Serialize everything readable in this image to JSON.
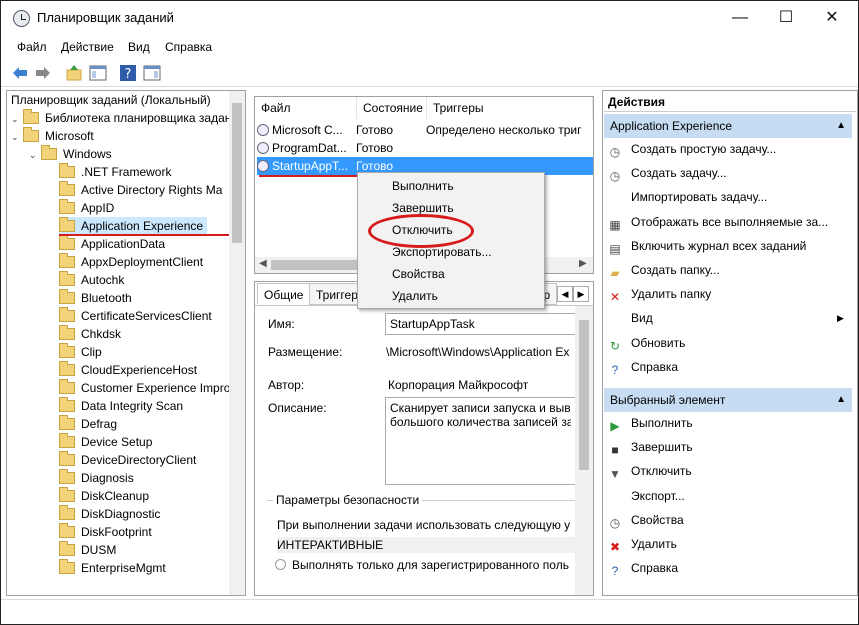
{
  "window": {
    "title": "Планировщик заданий"
  },
  "menu": [
    "Файл",
    "Действие",
    "Вид",
    "Справка"
  ],
  "tree": {
    "root": "Планировщик заданий (Локальный)",
    "library": "Библиотека планировщика заданий",
    "microsoft": "Microsoft",
    "windows": "Windows",
    "items": [
      ".NET Framework",
      "Active Directory Rights Ma",
      "AppID",
      "Application Experience",
      "ApplicationData",
      "AppxDeploymentClient",
      "Autochk",
      "Bluetooth",
      "CertificateServicesClient",
      "Chkdsk",
      "Clip",
      "CloudExperienceHost",
      "Customer Experience Impro",
      "Data Integrity Scan",
      "Defrag",
      "Device Setup",
      "DeviceDirectoryClient",
      "Diagnosis",
      "DiskCleanup",
      "DiskDiagnostic",
      "DiskFootprint",
      "DUSM",
      "EnterpriseMgmt"
    ]
  },
  "tasks": {
    "columns": [
      "Файл",
      "Состояние",
      "Триггеры"
    ],
    "rows": [
      {
        "name": "Microsoft C...",
        "status": "Готово",
        "trigger": "Определено несколько триг"
      },
      {
        "name": "ProgramDat...",
        "status": "Готово",
        "trigger": ""
      },
      {
        "name": "StartupAppT...",
        "status": "Готово",
        "trigger": ""
      }
    ]
  },
  "context_menu": [
    "Выполнить",
    "Завершить",
    "Отключить",
    "Экспортировать...",
    "Свойства",
    "Удалить"
  ],
  "detail": {
    "tabs": [
      "Общие",
      "Триггер",
      "тр"
    ],
    "name_label": "Имя:",
    "name_value": "StartupAppTask",
    "location_label": "Размещение:",
    "location_value": "\\Microsoft\\Windows\\Application Ex",
    "author_label": "Автор:",
    "author_value": "Корпорация Майкрософт",
    "desc_label": "Описание:",
    "desc_value_1": "Сканирует записи запуска и выво",
    "desc_value_2": "большого количества записей за",
    "security_title": "Параметры безопасности",
    "security_run_as": "При выполнении задачи использовать следующую у",
    "security_user": "ИНТЕРАКТИВНЫЕ",
    "security_opt": "Выполнять только для зарегистрированного поль"
  },
  "actions": {
    "header": "Действия",
    "group1": "Application Experience",
    "items1": [
      "Создать простую задачу...",
      "Создать задачу...",
      "Импортировать задачу...",
      "Отображать все выполняемые за...",
      "Включить журнал всех заданий",
      "Создать папку...",
      "Удалить папку",
      "Вид",
      "Обновить",
      "Справка"
    ],
    "group2": "Выбранный элемент",
    "items2": [
      "Выполнить",
      "Завершить",
      "Отключить",
      "Экспорт...",
      "Свойства",
      "Удалить",
      "Справка"
    ]
  },
  "colors": {
    "selection": "#cce8ff",
    "highlight": "#3399ff",
    "annotation": "#d71a1a"
  }
}
